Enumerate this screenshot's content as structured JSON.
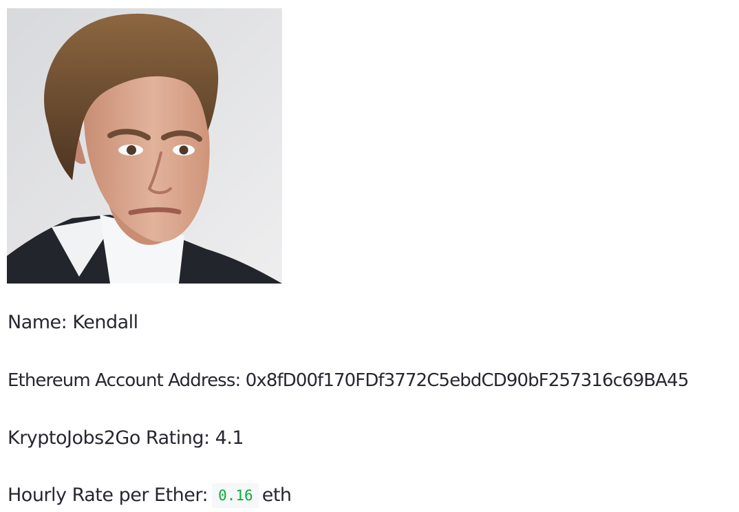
{
  "profile": {
    "photo_alt": "Kendall",
    "name_label": "Name:",
    "name_value": "Kendall",
    "address_label": "Ethereum Account Address:",
    "address_value": "0x8fD00f170FDf3772C5ebdCD90bF257316c69BA45",
    "rating_label": "KryptoJobs2Go Rating:",
    "rating_value": "4.1",
    "rate_label": "Hourly Rate per Ether:",
    "rate_value": "0.16",
    "rate_unit": "eth"
  },
  "colors": {
    "text": "#262730",
    "code_text": "#09ab3b",
    "code_background": "#f6f7f9",
    "photo_background": "#e6e7e9"
  }
}
